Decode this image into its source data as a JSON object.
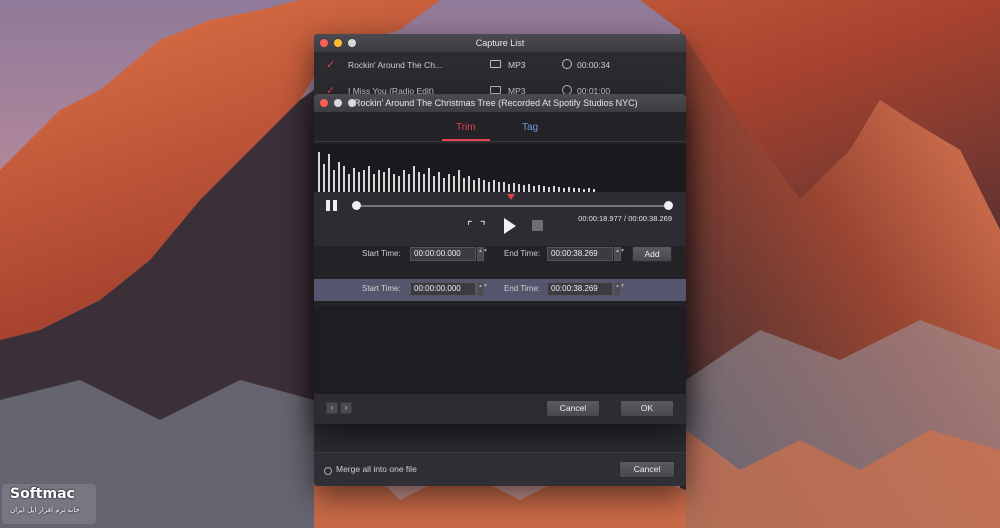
{
  "capture_window": {
    "title": "Capture List",
    "rows": [
      {
        "title": "Rockin' Around The Ch...",
        "format": "MP3",
        "duration": "00:00:34"
      },
      {
        "title": "I Miss You (Radio Edit)",
        "format": "MP3",
        "duration": "00:01:00"
      }
    ],
    "merge_label": "Merge all into one file",
    "cancel_label": "Cancel"
  },
  "trim_dialog": {
    "title": "Rockin' Around The Christmas Tree (Recorded At Spotify Studios NYC)",
    "tabs": [
      {
        "label": "Trim",
        "active": true
      },
      {
        "label": "Tag",
        "active": false
      }
    ],
    "time_readout": "00:00:18.977 / 00:00:38.269",
    "playhead_fraction": 0.496,
    "editor_row": {
      "start_label": "Start Time:",
      "start_value": "00:00:00.000",
      "end_label": "End Time:",
      "end_value": "00:00:38.269",
      "add_label": "Add"
    },
    "segment_row": {
      "start_label": "Start Time:",
      "start_value": "00:00:00.000",
      "end_label": "End Time:",
      "end_value": "00:00:38.269"
    },
    "cancel_label": "Cancel",
    "ok_label": "OK"
  },
  "watermark": {
    "brand": "Softmac",
    "subtitle": "خانه نرم افزار اپل ایران"
  },
  "colors": {
    "accent": "#e34250",
    "window_bg": "#2b2b30",
    "dialog_bg": "#222227"
  }
}
